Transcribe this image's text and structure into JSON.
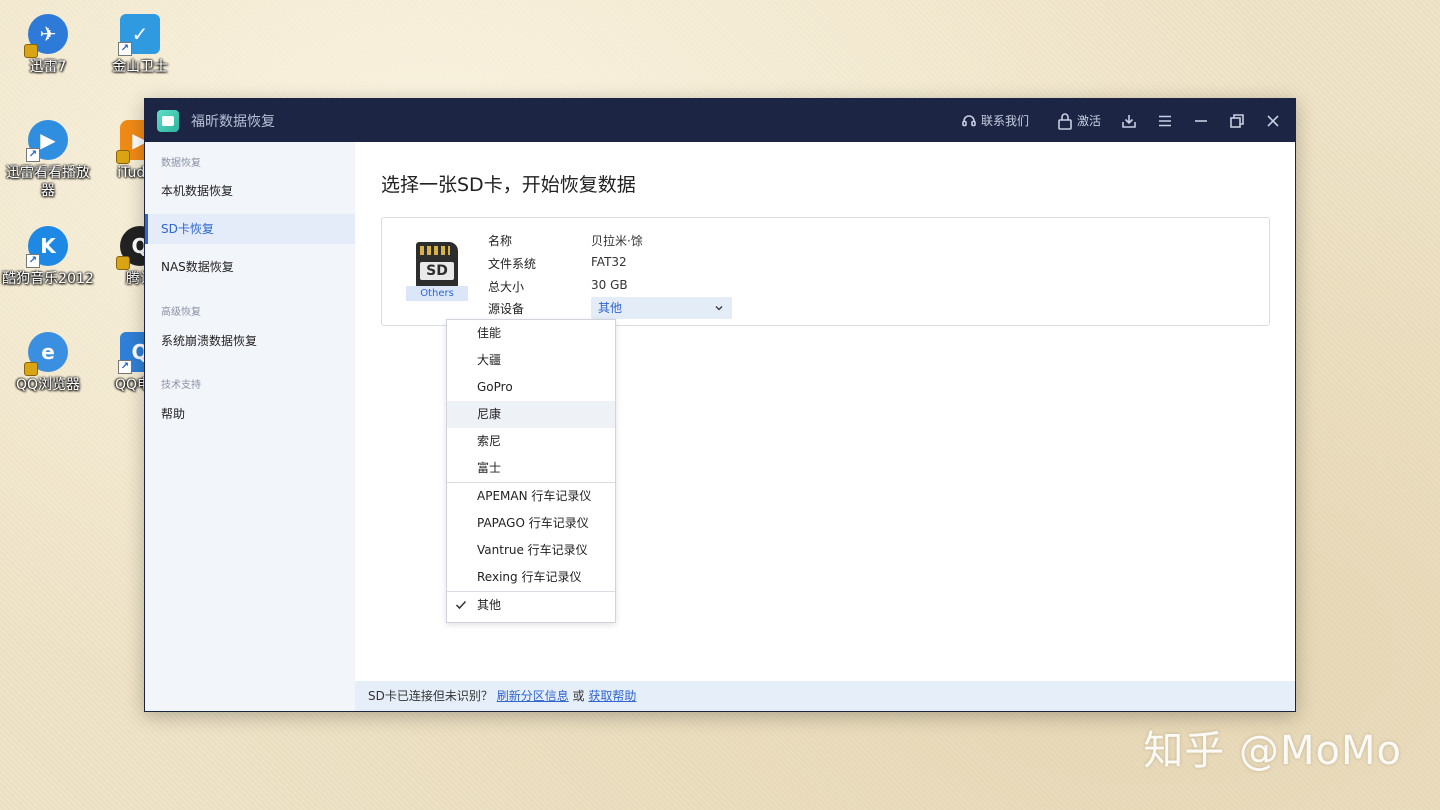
{
  "desktop": {
    "icons": [
      {
        "label": "迅雷7",
        "glyph": "✈",
        "color": "#2e7ad8"
      },
      {
        "label": "金山卫士",
        "glyph": "✓",
        "color": "#2f9ae0"
      },
      {
        "label": "迅雷看看播放器",
        "glyph": "▶",
        "color": "#2f8ee0"
      },
      {
        "label": "iTudou",
        "glyph": "▶",
        "color": "#f08a16"
      },
      {
        "label": "酷狗音乐2012",
        "glyph": "K",
        "color": "#1e88e5"
      },
      {
        "label": "腾讯",
        "glyph": "Q",
        "color": "#222222"
      },
      {
        "label": "QQ浏览器",
        "glyph": "e",
        "color": "#3b8fe0"
      },
      {
        "label": "QQ电脑",
        "glyph": "Q",
        "color": "#2f80d8"
      }
    ]
  },
  "window": {
    "title": "福昕数据恢复",
    "toolbar": {
      "contact_label": "联系我们",
      "activate_label": "激活"
    }
  },
  "sidebar": {
    "section_data": "数据恢复",
    "item_local": "本机数据恢复",
    "item_sd": "SD卡恢复",
    "item_nas": "NAS数据恢复",
    "section_advanced": "高级恢复",
    "item_crash": "系统崩溃数据恢复",
    "section_support": "技术支持",
    "item_help": "帮助"
  },
  "main": {
    "title": "选择一张SD卡，开始恢复数据",
    "card": {
      "icon_text": "SD",
      "icon_badge": "Others",
      "name_label": "名称",
      "name_value": "贝拉米·馀",
      "fs_label": "文件系统",
      "fs_value": "FAT32",
      "size_label": "总大小",
      "size_value": "30 GB",
      "source_label": "源设备",
      "source_selected": "其他"
    },
    "dropdown": {
      "group1": [
        "佳能",
        "大疆",
        "GoPro",
        "尼康",
        "索尼",
        "富士"
      ],
      "group2": [
        "APEMAN 行车记录仪",
        "PAPAGO 行车记录仪",
        "Vantrue 行车记录仪",
        "Rexing 行车记录仪"
      ],
      "group3": [
        "其他"
      ]
    }
  },
  "statusbar": {
    "message": "SD卡已连接但未识别？",
    "link_refresh": "刷新分区信息",
    "or_text": "或",
    "link_help": "获取帮助"
  },
  "watermark": "知乎 @MoMo",
  "colors": {
    "accent": "#2f66d1",
    "titlebar": "#1c2544",
    "sidebar_bg": "#f2f5fa",
    "status_bg": "#e6eef9"
  }
}
